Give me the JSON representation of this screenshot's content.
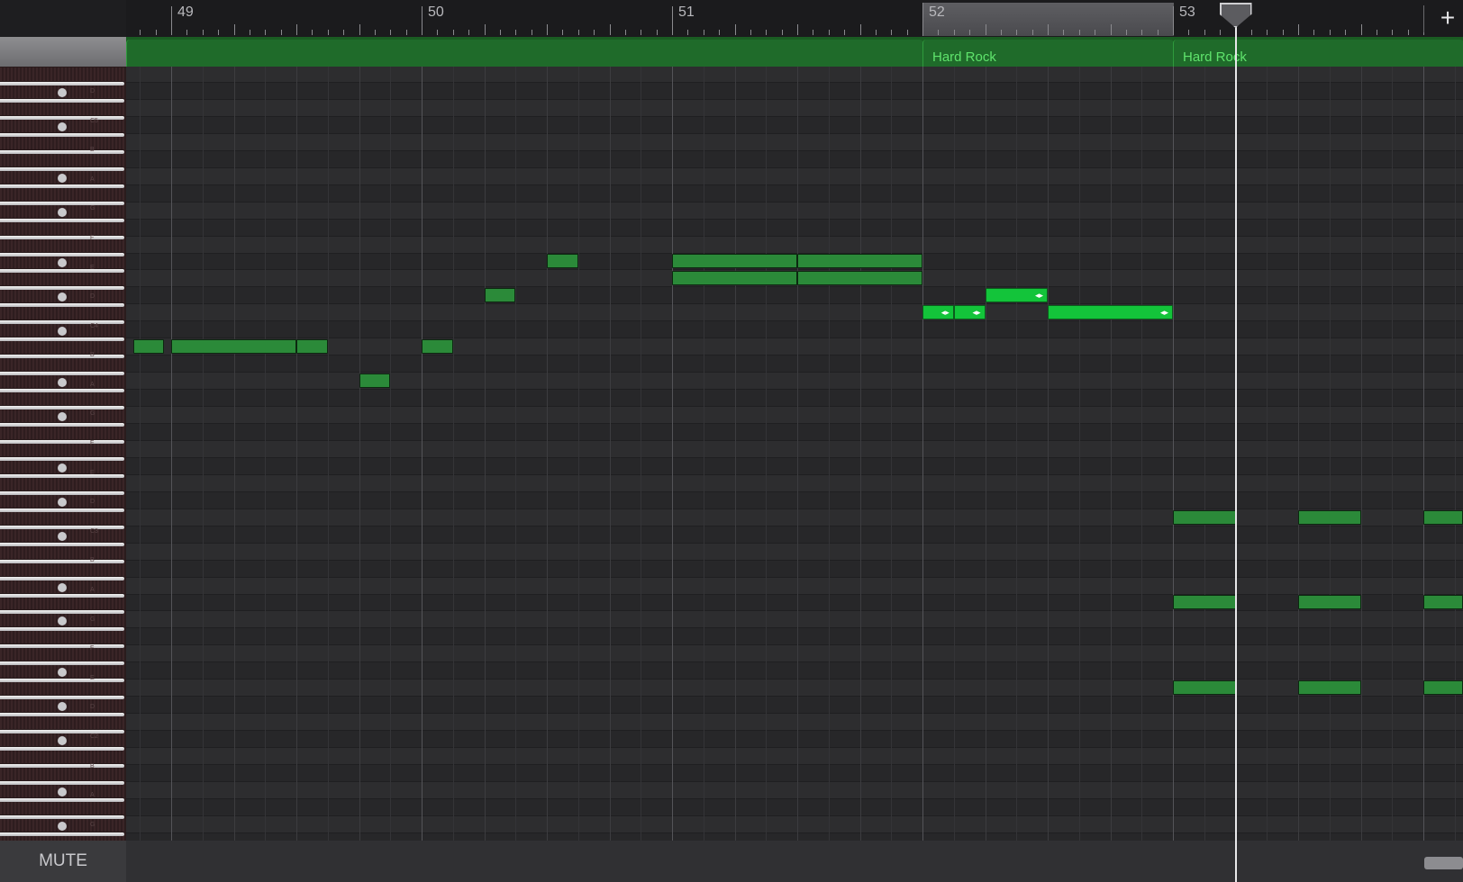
{
  "ruler": {
    "bars": [
      "49",
      "50",
      "51",
      "52",
      "53"
    ],
    "add_label": "+"
  },
  "regions": [
    {
      "label": ""
    },
    {
      "label": "Hard Rock"
    },
    {
      "label": "Hard Rock"
    }
  ],
  "keyboard": {
    "key_labels": [
      "D",
      "C5",
      "B",
      "A",
      "G",
      "F",
      "E",
      "D",
      "C4",
      "B",
      "A",
      "G",
      "F",
      "E",
      "D",
      "C3",
      "B",
      "A",
      "G",
      "F",
      "E",
      "D",
      "C2",
      "B",
      "A",
      "G"
    ]
  },
  "notes": [
    {
      "start": 48.85,
      "end": 48.97,
      "row": 16,
      "selected": false
    },
    {
      "start": 49.0,
      "end": 49.5,
      "row": 16,
      "selected": false
    },
    {
      "start": 49.5,
      "end": 49.625,
      "row": 16,
      "selected": false
    },
    {
      "start": 49.75,
      "end": 49.875,
      "row": 18,
      "selected": false
    },
    {
      "start": 50.0,
      "end": 50.125,
      "row": 16,
      "selected": false
    },
    {
      "start": 50.25,
      "end": 50.375,
      "row": 13,
      "selected": false
    },
    {
      "start": 50.5,
      "end": 50.625,
      "row": 11,
      "selected": false
    },
    {
      "start": 51.0,
      "end": 51.5,
      "row": 11,
      "selected": false
    },
    {
      "start": 51.5,
      "end": 52.0,
      "row": 11,
      "selected": false
    },
    {
      "start": 51.0,
      "end": 51.5,
      "row": 12,
      "selected": false
    },
    {
      "start": 51.5,
      "end": 52.0,
      "row": 12,
      "selected": false
    },
    {
      "start": 52.0,
      "end": 52.125,
      "row": 14,
      "selected": true
    },
    {
      "start": 52.125,
      "end": 52.25,
      "row": 14,
      "selected": true
    },
    {
      "start": 52.25,
      "end": 52.5,
      "row": 13,
      "selected": true
    },
    {
      "start": 52.5,
      "end": 53.0,
      "row": 14,
      "selected": true
    },
    {
      "start": 53.0,
      "end": 53.25,
      "row": 26,
      "selected": false
    },
    {
      "start": 53.5,
      "end": 53.75,
      "row": 26,
      "selected": false
    },
    {
      "start": 54.0,
      "end": 54.25,
      "row": 26,
      "selected": false
    },
    {
      "start": 53.0,
      "end": 53.25,
      "row": 31,
      "selected": false
    },
    {
      "start": 53.5,
      "end": 53.75,
      "row": 31,
      "selected": false
    },
    {
      "start": 54.0,
      "end": 54.25,
      "row": 31,
      "selected": false
    },
    {
      "start": 53.0,
      "end": 53.25,
      "row": 36,
      "selected": false
    },
    {
      "start": 53.5,
      "end": 53.75,
      "row": 36,
      "selected": false
    },
    {
      "start": 54.0,
      "end": 54.25,
      "row": 36,
      "selected": false
    }
  ],
  "playhead_bar": 53.25,
  "cycle_range": [
    52,
    53
  ],
  "footer": {
    "mute_label": "MUTE"
  },
  "colors": {
    "note": "#2b8a39",
    "note_selected": "#13c43a",
    "region": "#1f6b2a",
    "region_label": "#5fe36c"
  }
}
